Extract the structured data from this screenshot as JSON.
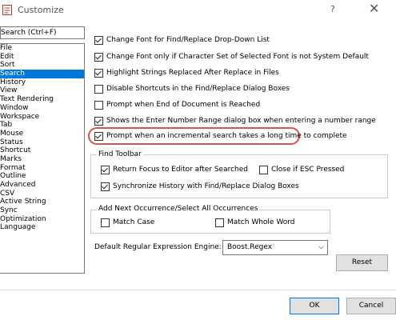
{
  "window": {
    "title": "Customize",
    "help_glyph": "?",
    "close_glyph": "✕",
    "accent_color": "#0078d7",
    "highlight_color": "#d9534f"
  },
  "search": {
    "placeholder": "Search (Ctrl+F)"
  },
  "categories": [
    {
      "label": "File",
      "selected": false
    },
    {
      "label": "Edit",
      "selected": false
    },
    {
      "label": "Sort",
      "selected": false
    },
    {
      "label": "Search",
      "selected": true
    },
    {
      "label": "History",
      "selected": false
    },
    {
      "label": "View",
      "selected": false
    },
    {
      "label": "Text Rendering",
      "selected": false
    },
    {
      "label": "Window",
      "selected": false
    },
    {
      "label": "Workspace",
      "selected": false
    },
    {
      "label": "Tab",
      "selected": false
    },
    {
      "label": "Mouse",
      "selected": false
    },
    {
      "label": "Status",
      "selected": false
    },
    {
      "label": "Shortcut",
      "selected": false
    },
    {
      "label": "Marks",
      "selected": false
    },
    {
      "label": "Format",
      "selected": false
    },
    {
      "label": "Outline",
      "selected": false
    },
    {
      "label": "Advanced",
      "selected": false
    },
    {
      "label": "CSV",
      "selected": false
    },
    {
      "label": "Active String",
      "selected": false
    },
    {
      "label": "Sync",
      "selected": false
    },
    {
      "label": "Optimization",
      "selected": false
    },
    {
      "label": "Language",
      "selected": false
    }
  ],
  "options": [
    {
      "label": "Change Font for Find/Replace Drop-Down List",
      "checked": true
    },
    {
      "label": "Change Font only if Character Set of Selected Font is not System Default",
      "checked": true
    },
    {
      "label": "Highlight Strings Replaced After Replace in Files",
      "checked": true
    },
    {
      "label": "Disable Shortcuts in the Find/Replace Dialog Boxes",
      "checked": false
    },
    {
      "label": "Prompt when End of Document is Reached",
      "checked": false
    },
    {
      "label": "Shows the Enter Number Range dialog box when entering a number range",
      "checked": true
    },
    {
      "label": "Prompt when an incremental search takes a long time to complete",
      "checked": true
    }
  ],
  "find_toolbar": {
    "title": "Find Toolbar",
    "return_focus": {
      "label": "Return Focus to Editor after Searched",
      "checked": true
    },
    "close_esc": {
      "label": "Close if ESC Pressed",
      "checked": false
    },
    "sync_history": {
      "label": "Synchronize History with Find/Replace Dialog Boxes",
      "checked": true
    }
  },
  "add_next": {
    "title": "Add Next Occurrence/Select All Occurrences",
    "match_case": {
      "label": "Match Case",
      "checked": false
    },
    "match_whole_word": {
      "label": "Match Whole Word",
      "checked": false
    }
  },
  "regex": {
    "label": "Default Regular Expression Engine:",
    "value": "Boost.Regex",
    "arrow": "⌵"
  },
  "buttons": {
    "reset": "Reset",
    "ok": "OK",
    "cancel": "Cancel"
  }
}
